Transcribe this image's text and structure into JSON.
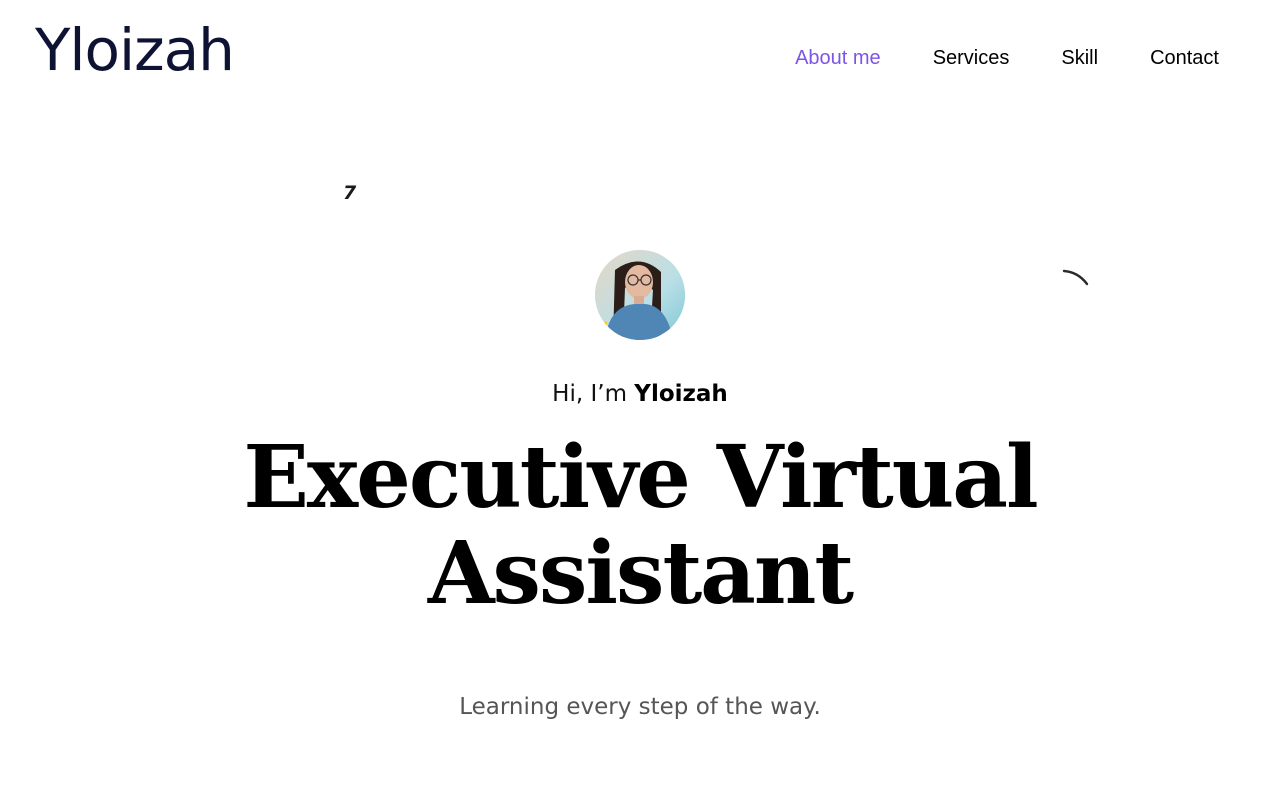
{
  "brand": {
    "logo_text": "Yloizah",
    "logo_color": "#0f1333"
  },
  "nav": {
    "items": [
      {
        "label": "About me",
        "active": true
      },
      {
        "label": "Services",
        "active": false
      },
      {
        "label": "Skill",
        "active": false
      },
      {
        "label": "Contact",
        "active": false
      }
    ],
    "active_color": "#7d55e6"
  },
  "hero": {
    "greeting_prefix": "Hi, I’m ",
    "greeting_name": "Yloizah",
    "headline_line1": "Executive Virtual",
    "headline_line2": "Assistant",
    "tagline": "Learning every step of the way.",
    "avatar_icon": "profile-photo"
  },
  "decorations": {
    "seven_glyph": "7",
    "arc_icon": "arc-stroke-icon"
  }
}
